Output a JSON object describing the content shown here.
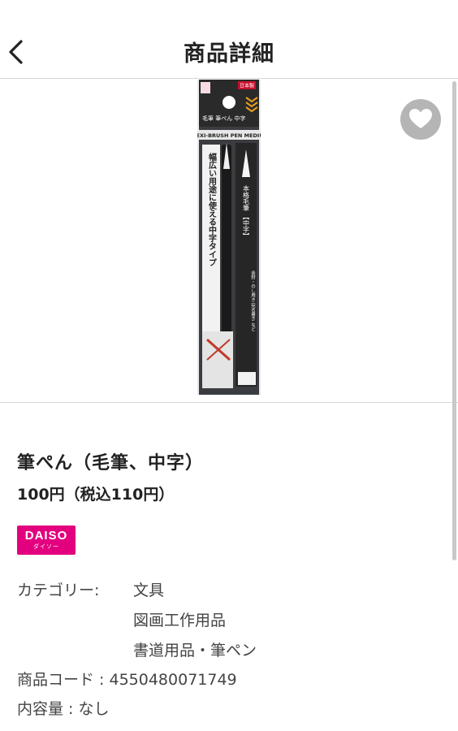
{
  "header": {
    "title": "商品詳細",
    "back_icon": "chevron-left-icon"
  },
  "product": {
    "favorite_icon": "heart-icon",
    "image_description_icon": "brush-pen-package",
    "package_texts": {
      "top_left": "毛筆 筆ぺん 中字",
      "band": "FLEXI-BRUSH PEN MEDIUM",
      "made_in": "日本製",
      "vertical_main": "幅広い用途に使える中字タイプ",
      "pen_label": "本格毛筆 【中字】",
      "pen_sub": "金封・のし用き 宛名書き など"
    },
    "name": "筆ぺん（毛筆、中字）",
    "price": "100円（税込110円）"
  },
  "brand": {
    "logo_line1": "DAISO",
    "logo_line2": "ダイソー",
    "color": "#e3007f"
  },
  "details": {
    "category_label": "カテゴリー:",
    "categories": [
      "文具",
      "図画工作用品",
      "書道用品・筆ペン"
    ],
    "code": "商品コード : 4550480071749",
    "volume": "内容量 : なし"
  }
}
